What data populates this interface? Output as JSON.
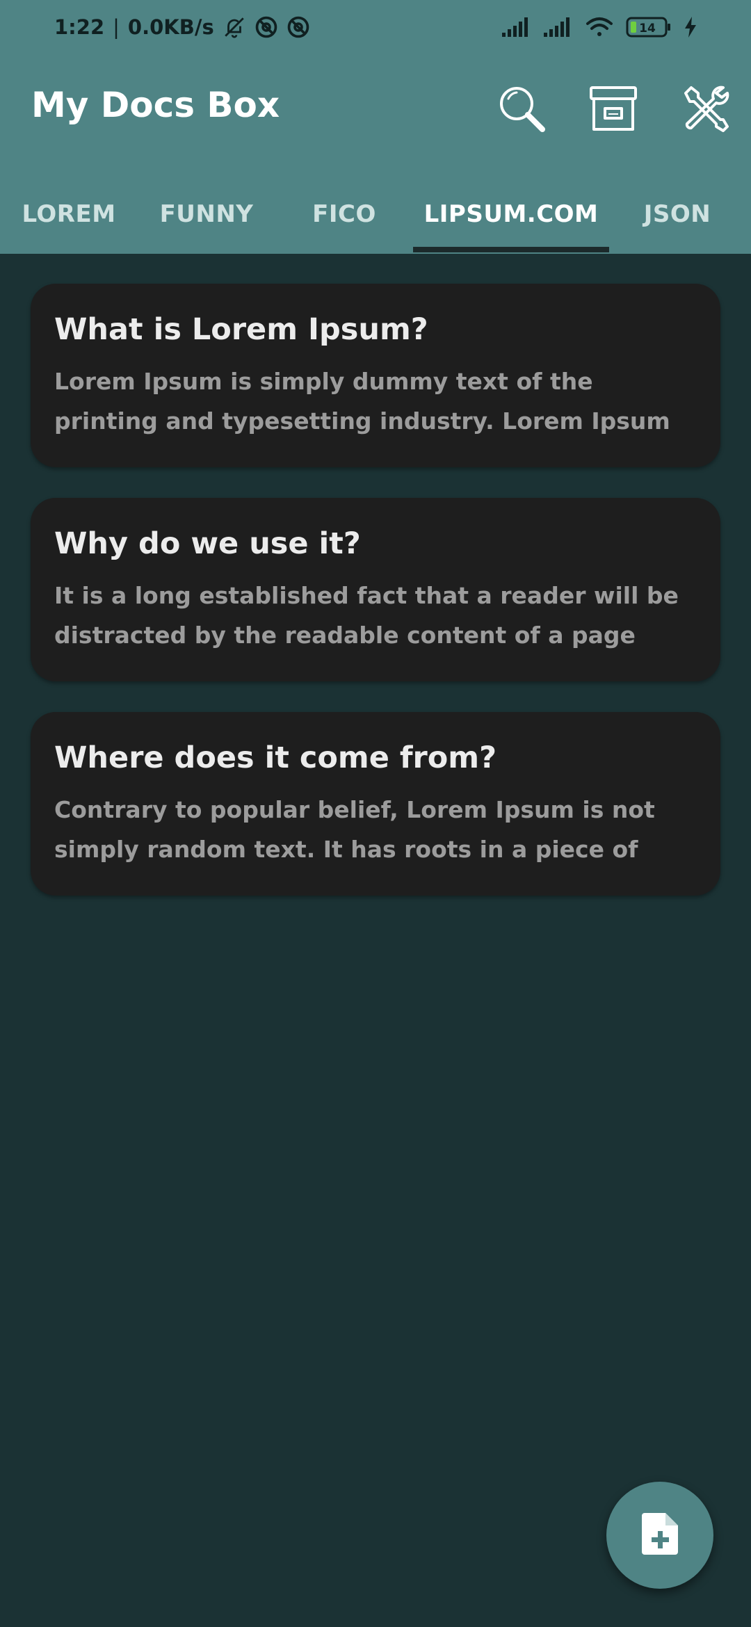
{
  "status_bar": {
    "time": "1:22",
    "separator": "|",
    "net_speed": "0.0KB/s",
    "battery_level": "14",
    "icons": [
      "bell-off-icon",
      "at-circle-icon",
      "at-circle-icon",
      "signal-icon",
      "signal-icon",
      "wifi-icon",
      "battery-icon",
      "charging-icon"
    ]
  },
  "app_bar": {
    "title": "My Docs Box",
    "actions": [
      "search-icon",
      "archive-icon",
      "tools-icon"
    ]
  },
  "tabs": {
    "items": [
      {
        "label": "LOREM"
      },
      {
        "label": "FUNNY"
      },
      {
        "label": "FICO"
      },
      {
        "label": "LIPSUM.COM"
      },
      {
        "label": "JSON"
      }
    ],
    "selected": "LIPSUM.COM"
  },
  "cards": [
    {
      "title": "What is Lorem Ipsum?",
      "body": "Lorem Ipsum is simply dummy text of the printing and typesetting industry. Lorem Ipsum has been the"
    },
    {
      "title": "Why do we use it?",
      "body": "It is a long established fact that a reader will be distracted by the readable content of a page when"
    },
    {
      "title": "Where does it come from?",
      "body": "Contrary to popular belief, Lorem Ipsum is not simply random text. It has roots in a piece of classical"
    }
  ],
  "fab": {
    "icon": "new-document-icon"
  },
  "colors": {
    "primary": "#4f8485",
    "background": "#1b3234",
    "card": "#1e1e1e",
    "title_text": "#ececec",
    "body_text": "#9c9c9c"
  }
}
